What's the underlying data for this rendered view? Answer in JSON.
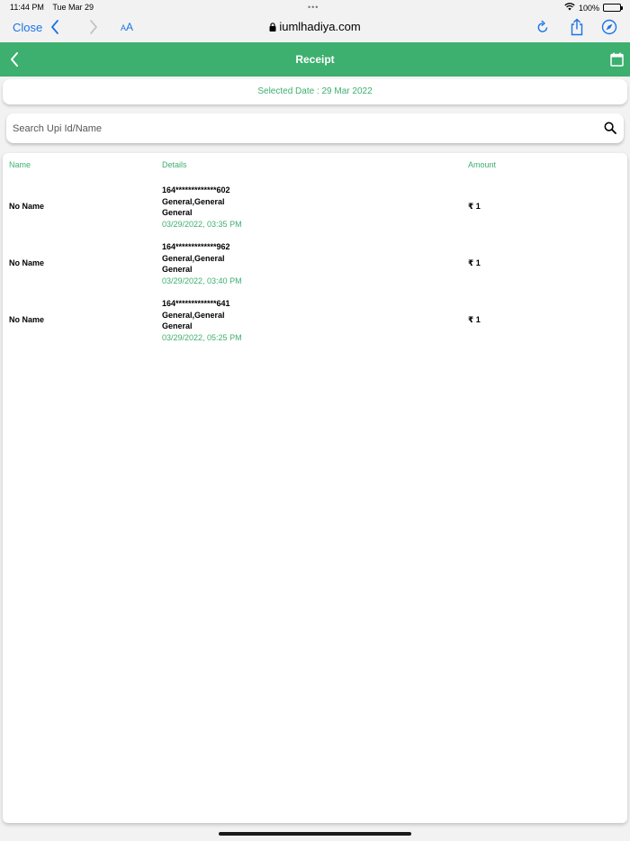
{
  "status_bar": {
    "time": "11:44 PM",
    "date": "Tue Mar 29",
    "dots": "•••",
    "battery": "100%",
    "icons": [
      "wifi-icon",
      "battery-icon"
    ]
  },
  "browser": {
    "close_label": "Close",
    "text_size_label_small": "A",
    "text_size_label_large": "A",
    "url": "iumlhadiya.com",
    "icons": [
      "chevron-left-icon",
      "chevron-right-icon",
      "lock-icon",
      "reload-icon",
      "share-icon",
      "compass-icon"
    ]
  },
  "header": {
    "title": "Receipt",
    "icons": [
      "chevron-left-icon",
      "calendar-icon"
    ]
  },
  "selected_date": "Selected Date : 29 Mar 2022",
  "search": {
    "placeholder": "Search Upi Id/Name",
    "value": ""
  },
  "table": {
    "headers": {
      "name": "Name",
      "details": "Details",
      "amount": "Amount"
    },
    "rows": [
      {
        "name": "No Name",
        "upi": "164*************602",
        "line2": "General,General",
        "line3": "General",
        "timestamp": "03/29/2022, 03:35 PM",
        "amount": "₹ 1"
      },
      {
        "name": "No Name",
        "upi": "164*************962",
        "line2": "General,General",
        "line3": "General",
        "timestamp": "03/29/2022, 03:40 PM",
        "amount": "₹ 1"
      },
      {
        "name": "No Name",
        "upi": "164*************641",
        "line2": "General,General",
        "line3": "General",
        "timestamp": "03/29/2022, 05:25 PM",
        "amount": "₹ 1"
      }
    ]
  },
  "colors": {
    "brand_green": "#3daf6f",
    "link_blue": "#1a73e8"
  }
}
